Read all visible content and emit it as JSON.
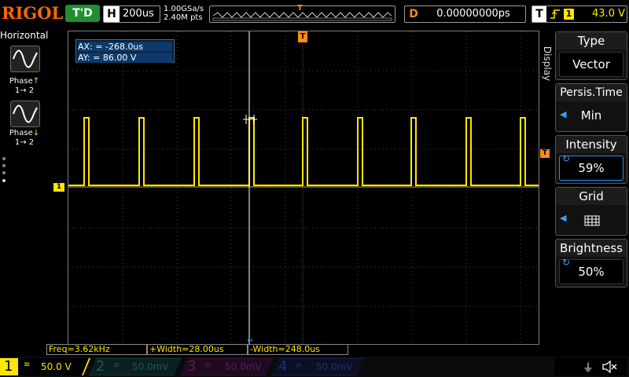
{
  "header": {
    "brand": "RIGOL",
    "run_state": "T'D",
    "timebase_label": "H",
    "timebase_value": "200us",
    "sample_rate": "1.00GSa/s",
    "memory_depth": "2.40M pts",
    "trigger_pos_marker": "T",
    "delay_label": "D",
    "delay_value": "0.00000000ps",
    "trigger_label": "T",
    "trigger_channel": "1",
    "trigger_level": "43.0 V"
  },
  "left_panel": {
    "title": "Horizontal",
    "item1_label": "Phase↑\n1→ 2",
    "item1_name": "Phase",
    "item1_sub": "1→ 2",
    "item2_name": "Phase",
    "item2_sub": "1→ 2"
  },
  "cursor": {
    "ax": "AX:      =  -268.0us",
    "ay": "AY:      =   86.00 V"
  },
  "channel_marker": "1",
  "trigger_marker_right": "T",
  "measurements": {
    "freq": "Freq=3.62kHz",
    "pwidth": "+Width=28.00us",
    "nwidth": "-Width=248.0us"
  },
  "channels": [
    {
      "num": "1",
      "scale": "50.0 V",
      "active": true
    },
    {
      "num": "2",
      "scale": "50.0mV",
      "active": false
    },
    {
      "num": "3",
      "scale": "50.0mV",
      "active": false
    },
    {
      "num": "4",
      "scale": "50.0mV",
      "active": false
    }
  ],
  "menu": {
    "tab": "Display",
    "items": [
      {
        "title": "Type",
        "value": "Vector"
      },
      {
        "title": "Persis.Time",
        "value": "Min"
      },
      {
        "title": "Intensity",
        "value": "59%"
      },
      {
        "title": "Grid",
        "value": ""
      },
      {
        "title": "Brightness",
        "value": "50%"
      }
    ]
  },
  "colors": {
    "ch1": "#ffe600",
    "ch2": "#00c8c8",
    "ch3": "#e000e0",
    "ch4": "#1e6bff",
    "trigger": "#ff8c1a",
    "brand": "#ff6600"
  }
}
